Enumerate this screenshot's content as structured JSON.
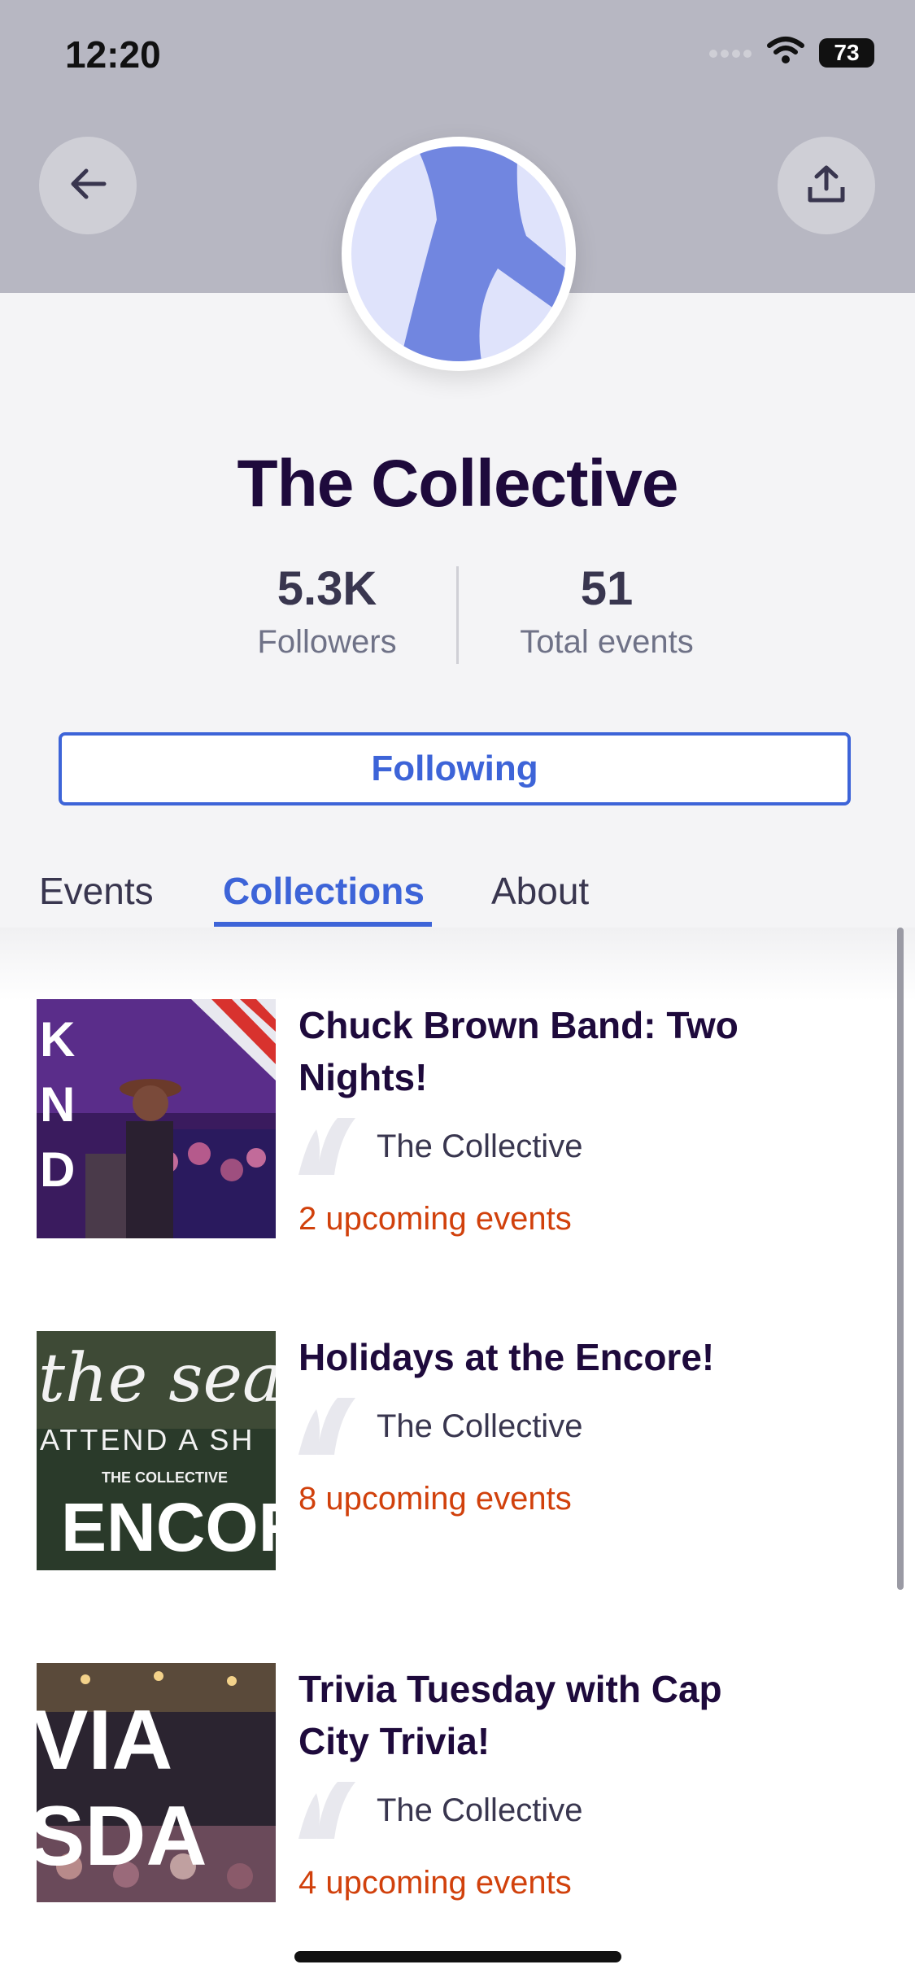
{
  "status_bar": {
    "time": "12:20",
    "battery": "73"
  },
  "header": {
    "back_icon": "arrow-left-icon",
    "share_icon": "share-upload-icon"
  },
  "profile": {
    "name": "The Collective",
    "followers_value": "5.3K",
    "followers_label": "Followers",
    "events_value": "51",
    "events_label": "Total events",
    "follow_button": "Following"
  },
  "tabs": [
    {
      "label": "Events",
      "active": false
    },
    {
      "label": "Collections",
      "active": true
    },
    {
      "label": "About",
      "active": false
    }
  ],
  "collections": [
    {
      "title": "Chuck Brown Band: Two Nights!",
      "organizer": "The Collective",
      "upcoming": "2 upcoming events"
    },
    {
      "title": "Holidays at the Encore!",
      "organizer": "The Collective",
      "upcoming": "8 upcoming events"
    },
    {
      "title": "Trivia Tuesday with Cap City Trivia!",
      "organizer": "The Collective",
      "upcoming": "4 upcoming events"
    }
  ],
  "thumb_text": {
    "c1": [
      "K",
      "N",
      "D"
    ],
    "c2": [
      "the sea",
      "ATTEND A SH",
      "THE COLLECTIVE",
      "ENCORE"
    ],
    "c3": [
      "VIA",
      "SDA"
    ]
  },
  "colors": {
    "accent": "#3d64d8",
    "orange": "#d1410c",
    "title": "#1e0a3c",
    "avatar_blue": "#7186e0"
  }
}
